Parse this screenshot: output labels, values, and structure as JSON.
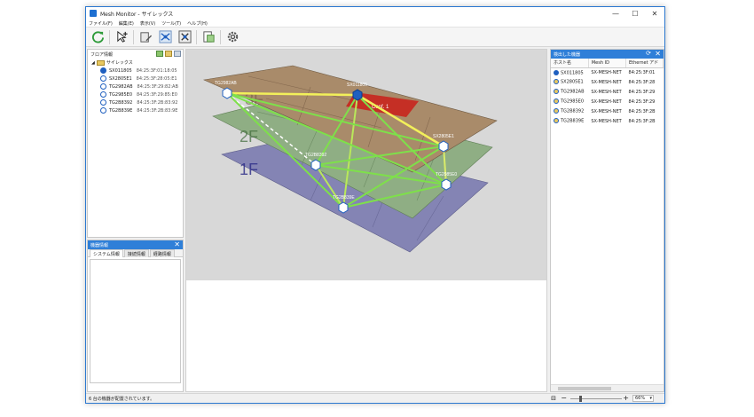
{
  "window": {
    "title": "Mesh Monitor - サイレックス",
    "controls": {
      "minimize": "—",
      "maximize": "☐",
      "close": "✕"
    }
  },
  "menu": [
    "ファイル(F)",
    "編集(E)",
    "表示(V)",
    "ツール(T)",
    "ヘルプ(H)"
  ],
  "toolbar": {
    "buttons": [
      "refresh-icon",
      "pointer-add-icon",
      "floor-edit-icon",
      "network-link-icon",
      "fit-view-icon",
      "report-icon",
      "settings-icon"
    ]
  },
  "floor_panel": {
    "title": "フロア情報",
    "root": "サイレックス",
    "devices": [
      {
        "name": "SX011805",
        "mac": "84:25:3F:01:18:05"
      },
      {
        "name": "SX2805E1",
        "mac": "84:25:3F:28:05:E1"
      },
      {
        "name": "TG2982AB",
        "mac": "84:25:3F:29:82:AB"
      },
      {
        "name": "TG2985E0",
        "mac": "84:25:3F:29:85:E0"
      },
      {
        "name": "TG2B8392",
        "mac": "84:25:3F:2B:83:92"
      },
      {
        "name": "TG2B839E",
        "mac": "84:25:3F:2B:83:9E"
      }
    ]
  },
  "device_info_panel": {
    "title": "機器情報",
    "tabs": [
      "システム情報",
      "接続情報",
      "経路情報"
    ]
  },
  "map": {
    "floors": [
      "3F",
      "2F",
      "1F"
    ],
    "conflict_label": "Conf. 1",
    "nodes": [
      {
        "id": "n1",
        "label": "TG2982AB"
      },
      {
        "id": "n2",
        "label": "SX011805"
      },
      {
        "id": "n3",
        "label": "SX2805E1"
      },
      {
        "id": "n4",
        "label": "TG2B8392"
      },
      {
        "id": "n5",
        "label": "TG2985E0"
      },
      {
        "id": "n6",
        "label": "TG2B839E"
      }
    ]
  },
  "detected_panel": {
    "title": "検出した機器",
    "columns": [
      "ホスト名",
      "Mesh ID",
      "Ethernet アド"
    ],
    "rows": [
      {
        "host": "SX011805",
        "mesh": "SX-MESH-NET",
        "eth": "84:25:3F:01"
      },
      {
        "host": "SX2805E1",
        "mesh": "SX-MESH-NET",
        "eth": "84:25:3F:28"
      },
      {
        "host": "TG2982AB",
        "mesh": "SX-MESH-NET",
        "eth": "84:25:3F:29"
      },
      {
        "host": "TG2985E0",
        "mesh": "SX-MESH-NET",
        "eth": "84:25:3F:29"
      },
      {
        "host": "TG2B8392",
        "mesh": "SX-MESH-NET",
        "eth": "84:25:3F:2B"
      },
      {
        "host": "TG2B839E",
        "mesh": "SX-MESH-NET",
        "eth": "84:25:3F:2B"
      }
    ]
  },
  "status": {
    "text": "6 台の機器が配置されています。",
    "zoom": "66%"
  }
}
